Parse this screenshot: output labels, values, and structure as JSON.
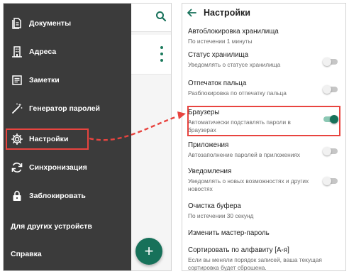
{
  "colors": {
    "drawer_bg": "#3b3b3b",
    "accent": "#17715a",
    "highlight": "#e8443f"
  },
  "left_screen": {
    "drawer": {
      "items": [
        {
          "label": "Документы",
          "icon": "documents-icon"
        },
        {
          "label": "Адреса",
          "icon": "building-icon"
        },
        {
          "label": "Заметки",
          "icon": "notes-icon"
        },
        {
          "label": "Генератор паролей",
          "icon": "magic-wand-icon"
        },
        {
          "label": "Настройки",
          "icon": "gear-icon"
        },
        {
          "label": "Синхронизация",
          "icon": "sync-icon"
        },
        {
          "label": "Заблокировать",
          "icon": "lock-icon"
        }
      ],
      "bottom_items": [
        {
          "label": "Для других устройств"
        },
        {
          "label": "Справка"
        }
      ]
    },
    "fab_label": "+"
  },
  "right_screen": {
    "title": "Настройки",
    "settings": [
      {
        "title": "Автоблокировка хранилища",
        "subtitle": "По истечении 1 минуты"
      },
      {
        "title": "Статус хранилища",
        "subtitle": "Уведомлять о статусе хранилища",
        "toggle": "off"
      },
      {
        "title": "Отпечаток пальца",
        "subtitle": "Разблокировка по отпечатку пальца",
        "toggle": "off"
      },
      {
        "title": "Браузеры",
        "subtitle": "Автоматически подставлять пароли в браузерах",
        "toggle": "on"
      },
      {
        "title": "Приложения",
        "subtitle": "Автозаполнение паролей в приложениях",
        "toggle": "off"
      },
      {
        "title": "Уведомления",
        "subtitle": "Уведомлять о новых возможностях и других новостях",
        "toggle": "off"
      },
      {
        "title": "Очистка буфера",
        "subtitle": "По истечении 30 секунд"
      },
      {
        "title": "Изменить мастер-пароль"
      },
      {
        "title": "Сортировать по алфавиту [А-я]",
        "subtitle": "Если вы меняли порядок записей, ваша текущая сортировка будет сброшена."
      }
    ]
  }
}
